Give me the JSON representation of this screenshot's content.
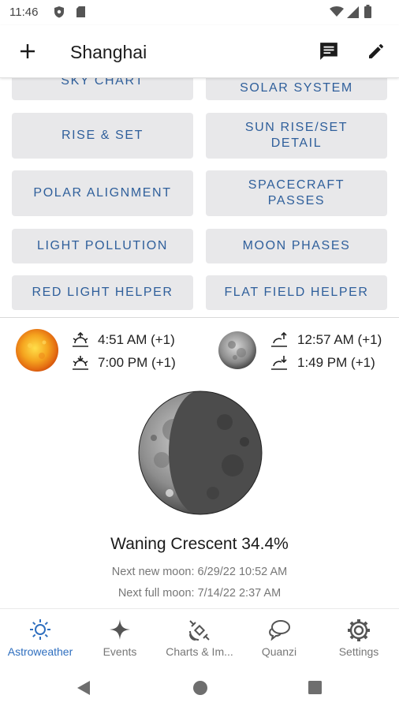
{
  "status_bar": {
    "time": "11:46"
  },
  "app_bar": {
    "title": "Shanghai"
  },
  "tools": [
    {
      "label": "SKY CHART"
    },
    {
      "label": "SOLAR SYSTEM"
    },
    {
      "label": "RISE & SET"
    },
    {
      "label": "SUN RISE/SET DETAIL"
    },
    {
      "label": "POLAR ALIGNMENT"
    },
    {
      "label": "SPACECRAFT PASSES"
    },
    {
      "label": "LIGHT POLLUTION"
    },
    {
      "label": "MOON PHASES"
    },
    {
      "label": "RED LIGHT HELPER"
    },
    {
      "label": "FLAT FIELD HELPER"
    }
  ],
  "sun": {
    "rise": "4:51 AM (+1)",
    "set": "7:00 PM (+1)"
  },
  "moon": {
    "rise": "12:57 AM (+1)",
    "set": "1:49 PM (+1)"
  },
  "moon_phase": {
    "name": "Waning Crescent 34.4%",
    "next_new": "Next new moon: 6/29/22 10:52 AM",
    "next_full": "Next full moon: 7/14/22 2:37 AM",
    "illumination": 0.344
  },
  "bottom_nav": [
    {
      "label": "Astroweather",
      "active": true
    },
    {
      "label": "Events"
    },
    {
      "label": "Charts & Im..."
    },
    {
      "label": "Quanzi"
    },
    {
      "label": "Settings"
    }
  ],
  "colors": {
    "accent": "#2f6fbf",
    "tile_bg": "#e8e8ea",
    "tile_text": "#2f5f9b"
  }
}
